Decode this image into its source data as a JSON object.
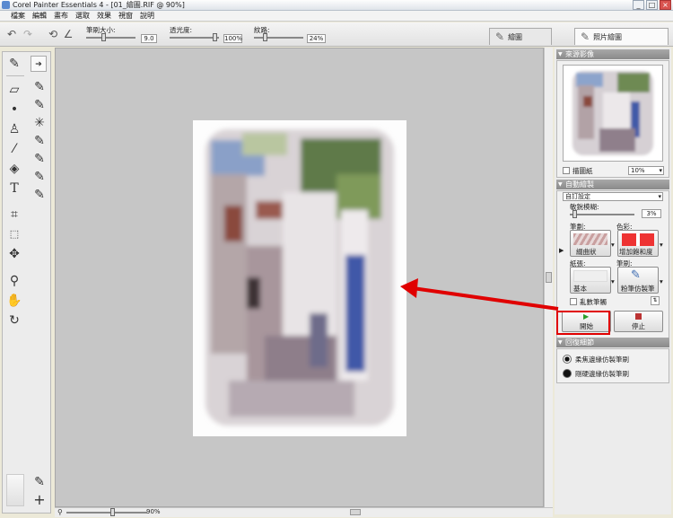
{
  "window": {
    "title": "Corel Painter Essentials 4 - [01_繪圖.RIF @ 90%]",
    "buttons": [
      "_",
      "□",
      "×"
    ]
  },
  "menu": [
    "檔案",
    "編輯",
    "畫布",
    "選取",
    "效果",
    "視窗",
    "說明"
  ],
  "toolbar": {
    "brush_size_label": "筆刷大小:",
    "brush_size_value": "9.0",
    "opacity_label": "透光度:",
    "opacity_value": "100%",
    "grain_label": "紋路:",
    "grain_value": "24%",
    "tab_paint": "繪圖",
    "tab_photo": "照片繪圖"
  },
  "canvas": {
    "zoom_value": "90%"
  },
  "right_panel": {
    "source_header": "來源影像",
    "tracing_paper_label": "描圖紙",
    "tracing_paper_value": "10%",
    "auto_header": "自動繪製",
    "preset_value": "自訂設定",
    "sensitivity_label": "敏銳模糊:",
    "sensitivity_value": "3%",
    "stroke_label": "筆劃:",
    "stroke_value": "綴曲狀",
    "color_label": "色彩:",
    "color_value": "增加飽和度",
    "paper_label": "紙張:",
    "paper_value": "基本",
    "brush_label": "筆刷:",
    "brush_value": "粉筆仿製筆",
    "random_stroke_label": "亂數筆觸",
    "start_label": "開始",
    "stop_label": "停止",
    "restore_header": "回復細節",
    "restore_items": [
      "柔焦邊緣仿製筆刷",
      "剛硬邊緣仿製筆刷"
    ]
  }
}
